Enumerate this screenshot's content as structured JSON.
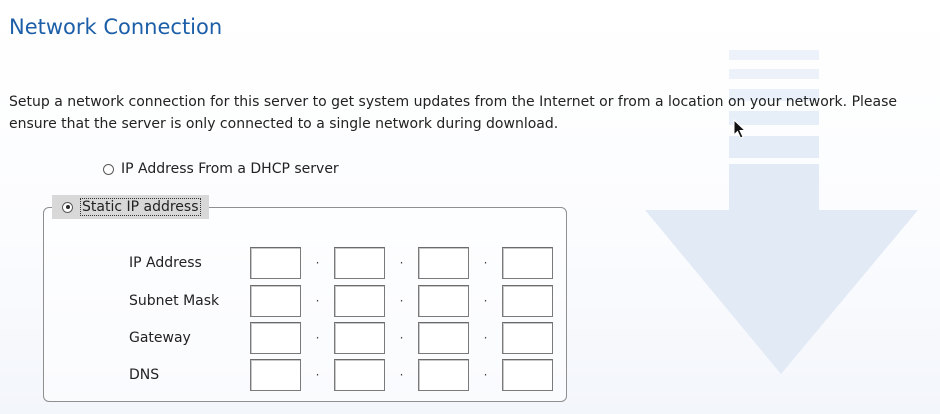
{
  "page": {
    "title": "Network Connection",
    "description": "Setup a network connection for this server to get system updates from the Internet or from a location on your network. Please ensure that the server is only connected to a single network during download."
  },
  "connection_options": {
    "dhcp": {
      "label": "IP Address From a DHCP server",
      "selected": false
    },
    "static": {
      "label": "Static IP address",
      "selected": true
    }
  },
  "static_fields": [
    {
      "label": "IP Address",
      "octets": [
        "",
        "",
        "",
        ""
      ]
    },
    {
      "label": "Subnet Mask",
      "octets": [
        "",
        "",
        "",
        ""
      ]
    },
    {
      "label": "Gateway",
      "octets": [
        "",
        "",
        "",
        ""
      ]
    },
    {
      "label": "DNS",
      "octets": [
        "",
        "",
        "",
        ""
      ]
    }
  ],
  "separator": "·",
  "colors": {
    "title": "#1c5fa8",
    "watermark_arrow": "#e6eef8"
  },
  "icons": {
    "watermark": "download-arrow-icon",
    "cursor": "mouse-pointer-icon"
  }
}
